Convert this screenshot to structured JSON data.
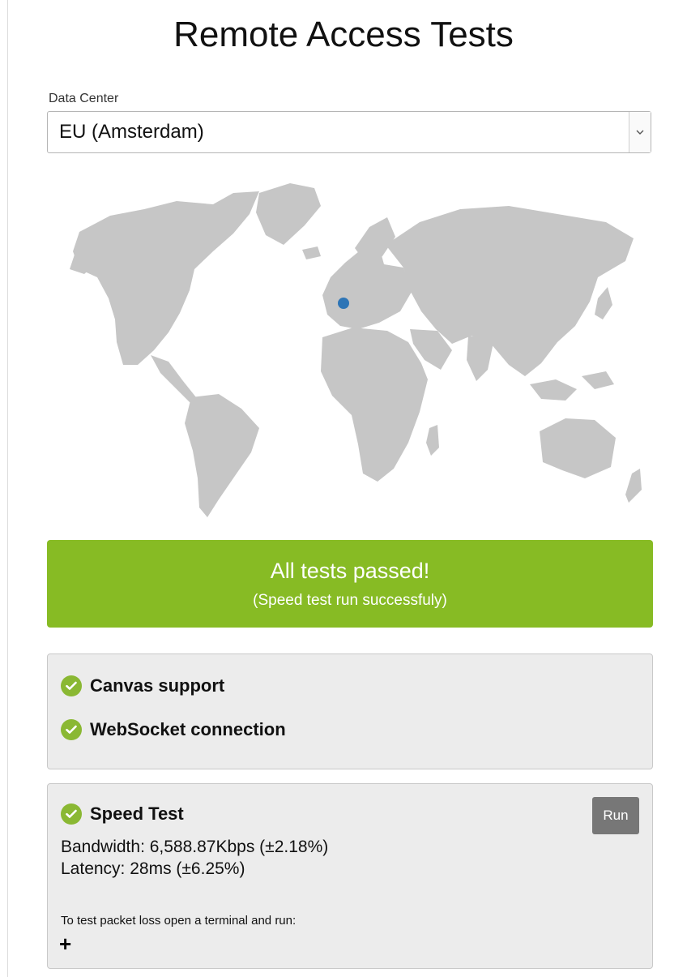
{
  "title": "Remote Access Tests",
  "data_center": {
    "label": "Data Center",
    "selected": "EU (Amsterdam)"
  },
  "map": {
    "marker_color": "#2e75b6",
    "land_color": "#c6c6c6"
  },
  "banner": {
    "title": "All tests passed!",
    "subtitle": "(Speed test run successfuly)",
    "color": "#87bb24"
  },
  "checks": [
    {
      "label": "Canvas support",
      "status": "passed"
    },
    {
      "label": "WebSocket connection",
      "status": "passed"
    }
  ],
  "speed_test": {
    "label": "Speed Test",
    "status": "passed",
    "run_label": "Run",
    "bandwidth": "Bandwidth: 6,588.87Kbps (±2.18%)",
    "latency": "Latency: 28ms (±6.25%)",
    "packet_loss_hint": "To test packet loss open a terminal and run:",
    "expand_glyph": "+"
  },
  "icons": {
    "check": "check-circle-icon",
    "dropdown": "chevron-down-icon",
    "expand": "plus-icon"
  }
}
